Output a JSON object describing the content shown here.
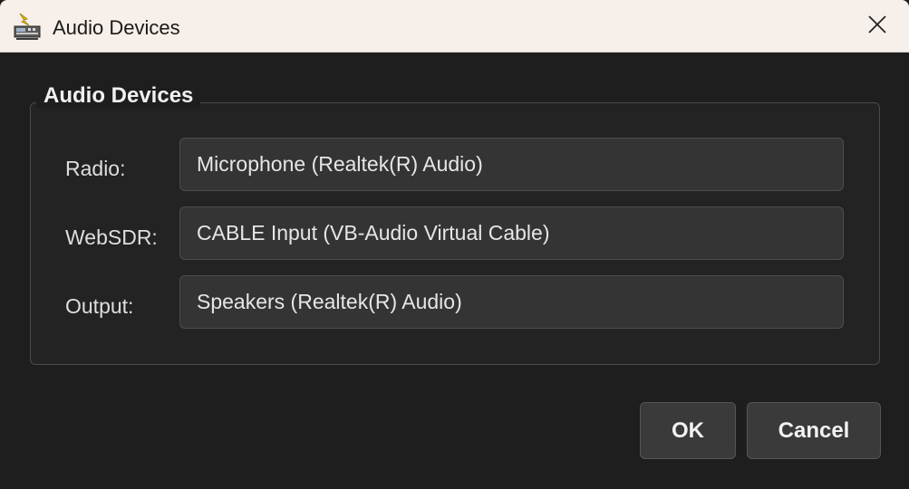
{
  "window": {
    "title": "Audio Devices",
    "icons": {
      "app": "app-radio-icon",
      "close": "close-icon"
    }
  },
  "group": {
    "title": "Audio Devices",
    "rows": [
      {
        "label": "Radio:",
        "value": "Microphone (Realtek(R) Audio)"
      },
      {
        "label": "WebSDR:",
        "value": "CABLE Input (VB-Audio Virtual Cable)"
      },
      {
        "label": "Output:",
        "value": "Speakers (Realtek(R) Audio)"
      }
    ]
  },
  "buttons": {
    "ok": "OK",
    "cancel": "Cancel"
  },
  "colors": {
    "titlebar": "#f7efe9",
    "background": "#1e1e1e",
    "field": "#343434",
    "button": "#3a3a3a"
  }
}
